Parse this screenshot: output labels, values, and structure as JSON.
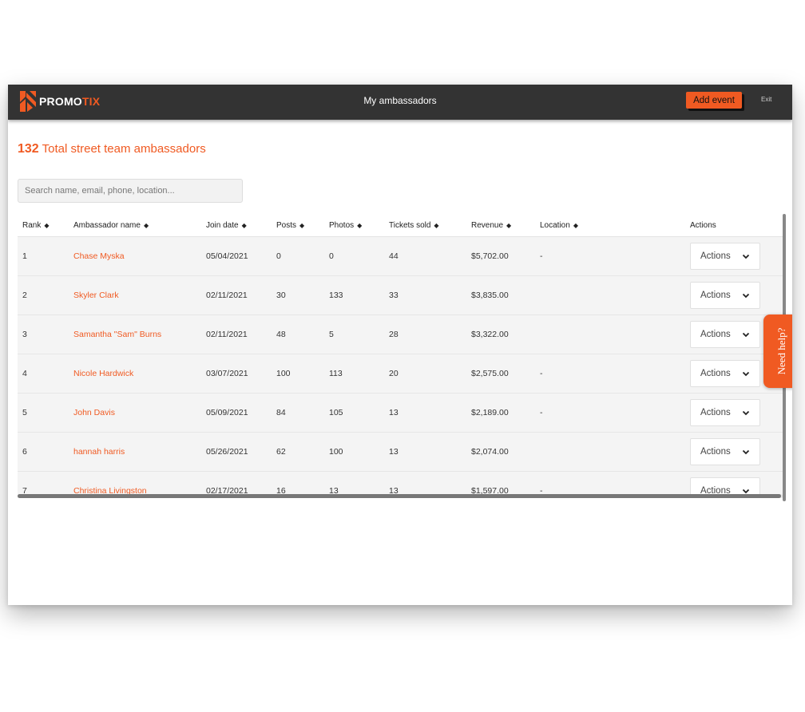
{
  "brand": {
    "name_main": "PROMO",
    "name_accent": "TIX"
  },
  "header": {
    "title": "My ambassadors",
    "add_event_label": "Add event",
    "exit_label": "Exit"
  },
  "summary": {
    "count": "132",
    "label": "Total street team ambassadors"
  },
  "search": {
    "placeholder": "Search name, email, phone, location..."
  },
  "table": {
    "columns": [
      "Rank",
      "Ambassador name",
      "Join date",
      "Posts",
      "Photos",
      "Tickets sold",
      "Revenue",
      "Location",
      "Actions"
    ],
    "rows": [
      {
        "rank": "1",
        "name": "Chase Myska",
        "join_date": "05/04/2021",
        "posts": "0",
        "photos": "0",
        "tickets": "44",
        "revenue": "$5,702.00",
        "location": "-"
      },
      {
        "rank": "2",
        "name": "Skyler Clark",
        "join_date": "02/11/2021",
        "posts": "30",
        "photos": "133",
        "tickets": "33",
        "revenue": "$3,835.00",
        "location": ""
      },
      {
        "rank": "3",
        "name": "Samantha \"Sam\" Burns",
        "join_date": "02/11/2021",
        "posts": "48",
        "photos": "5",
        "tickets": "28",
        "revenue": "$3,322.00",
        "location": ""
      },
      {
        "rank": "4",
        "name": "Nicole Hardwick",
        "join_date": "03/07/2021",
        "posts": "100",
        "photos": "113",
        "tickets": "20",
        "revenue": "$2,575.00",
        "location": "-"
      },
      {
        "rank": "5",
        "name": "John Davis",
        "join_date": "05/09/2021",
        "posts": "84",
        "photos": "105",
        "tickets": "13",
        "revenue": "$2,189.00",
        "location": "-"
      },
      {
        "rank": "6",
        "name": "hannah harris",
        "join_date": "05/26/2021",
        "posts": "62",
        "photos": "100",
        "tickets": "13",
        "revenue": "$2,074.00",
        "location": ""
      },
      {
        "rank": "7",
        "name": "Christina Livingston",
        "join_date": "02/17/2021",
        "posts": "16",
        "photos": "13",
        "tickets": "13",
        "revenue": "$1,597.00",
        "location": "-"
      }
    ],
    "action_label": "Actions"
  },
  "help": {
    "label": "Need help?"
  },
  "colors": {
    "accent": "#f05a22",
    "topbar": "#333333"
  }
}
